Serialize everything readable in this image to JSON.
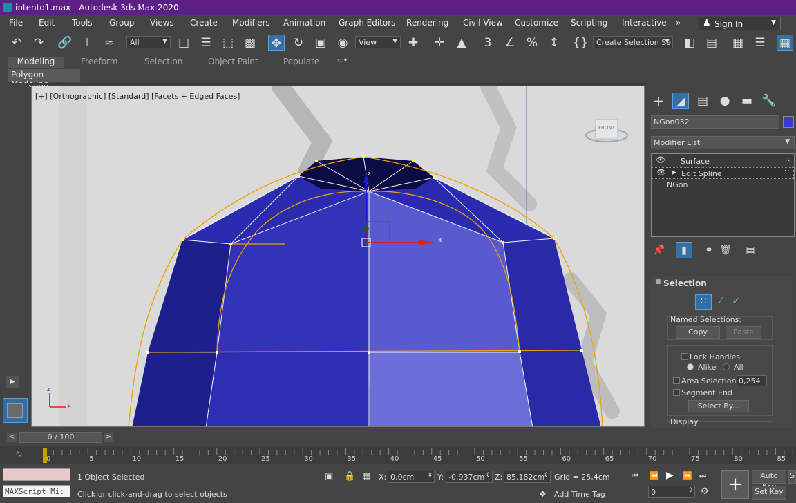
{
  "window": {
    "title": "intento1.max - Autodesk 3ds Max 2020"
  },
  "menu": {
    "items": [
      "File",
      "Edit",
      "Tools",
      "Group",
      "Views",
      "Create",
      "Modifiers",
      "Animation",
      "Graph Editors",
      "Rendering",
      "Civil View",
      "Customize",
      "Scripting",
      "Interactive"
    ],
    "more": "»",
    "sign_in": "Sign In"
  },
  "toolbar": {
    "filter_value": "All",
    "view_value": "View",
    "selection_set_value": "Create Selection Se"
  },
  "ribbon": {
    "tabs": [
      "Modeling",
      "Freeform",
      "Selection",
      "Object Paint",
      "Populate"
    ],
    "active_tab": "Modeling",
    "sub_label": "Polygon Modeling"
  },
  "viewport": {
    "label": "[+] [Orthographic] [Standard] [Facets + Edged Faces]",
    "viewcube": "FRONT",
    "gizmo_x": "x",
    "gizmo_z": "z"
  },
  "command_panel": {
    "object_name": "NGon032",
    "object_color": "#3a3ad0",
    "modifier_list": "Modifier List",
    "stack": [
      "Surface",
      "Edit Spline",
      "NGon"
    ],
    "selection_title": "Selection",
    "named_selections": "Named Selections:",
    "copy": "Copy",
    "paste": "Paste",
    "lock_handles": "Lock Handles",
    "alike": "Alike",
    "all": "All",
    "area_selection": "Area Selection:",
    "area_value": "0,254",
    "segment_end": "Segment End",
    "select_by": "Select By...",
    "display": "Display"
  },
  "timeline": {
    "position": "0 / 100",
    "ticks": [
      "0",
      "5",
      "10",
      "15",
      "20",
      "25",
      "30",
      "35",
      "40",
      "45",
      "50",
      "55",
      "60",
      "65",
      "70",
      "75",
      "80",
      "85"
    ]
  },
  "status": {
    "maxscript": "MAXScript Mi:",
    "objects_selected": "1 Object Selected",
    "hint": "Click or click-and-drag to select objects",
    "x_label": "X:",
    "x_value": "0,0cm",
    "y_label": "Y:",
    "y_value": "-0,937cm",
    "z_label": "Z:",
    "z_value": "85,182cm",
    "grid": "Grid = 25,4cm",
    "add_time_tag": "Add Time Tag",
    "auto_key": "Auto Key",
    "set_key": "Set Key",
    "frame_value": "0"
  },
  "colors": {
    "title_bar": "#5b1f86",
    "mesh_blue": "#2c2cb0",
    "spline_orange": "#f0a000"
  }
}
